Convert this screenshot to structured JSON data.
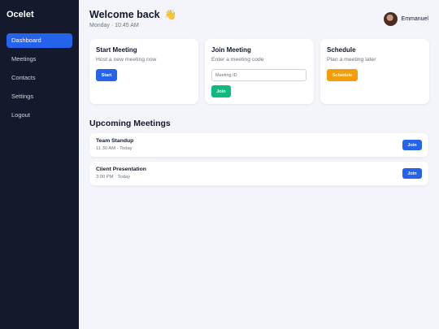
{
  "app": {
    "name": "Ocelet"
  },
  "sidebar": {
    "items": [
      {
        "label": "Dashboard",
        "active": true
      },
      {
        "label": "Meetings"
      },
      {
        "label": "Contacts"
      },
      {
        "label": "Settings"
      },
      {
        "label": "Logout"
      }
    ]
  },
  "header": {
    "greeting": "Welcome back",
    "greeting_icon": "waving-hand-icon",
    "date": "Monday · 10:45 AM",
    "user": {
      "name": "Emmanuel"
    }
  },
  "cards": {
    "start": {
      "title": "Start Meeting",
      "subtitle": "Host a new meeting now",
      "button": "Start"
    },
    "join": {
      "title": "Join Meeting",
      "subtitle": "Enter a meeting code",
      "placeholder": "Meeting ID",
      "button": "Join"
    },
    "schedule": {
      "title": "Schedule",
      "subtitle": "Plan a meeting later",
      "button": "Schedule"
    }
  },
  "upcoming": {
    "title": "Upcoming Meetings",
    "meetings": [
      {
        "title": "Team Standup",
        "time": "11:30 AM · Today",
        "button": "Join"
      },
      {
        "title": "Client Presentation",
        "time": "3:00 PM · Today",
        "button": "Join"
      }
    ]
  },
  "colors": {
    "sidebar_bg": "#141a2b",
    "accent": "#2563eb",
    "join_green": "#10b981",
    "schedule_amber": "#f59e0b",
    "page_bg": "#f4f5fb"
  }
}
